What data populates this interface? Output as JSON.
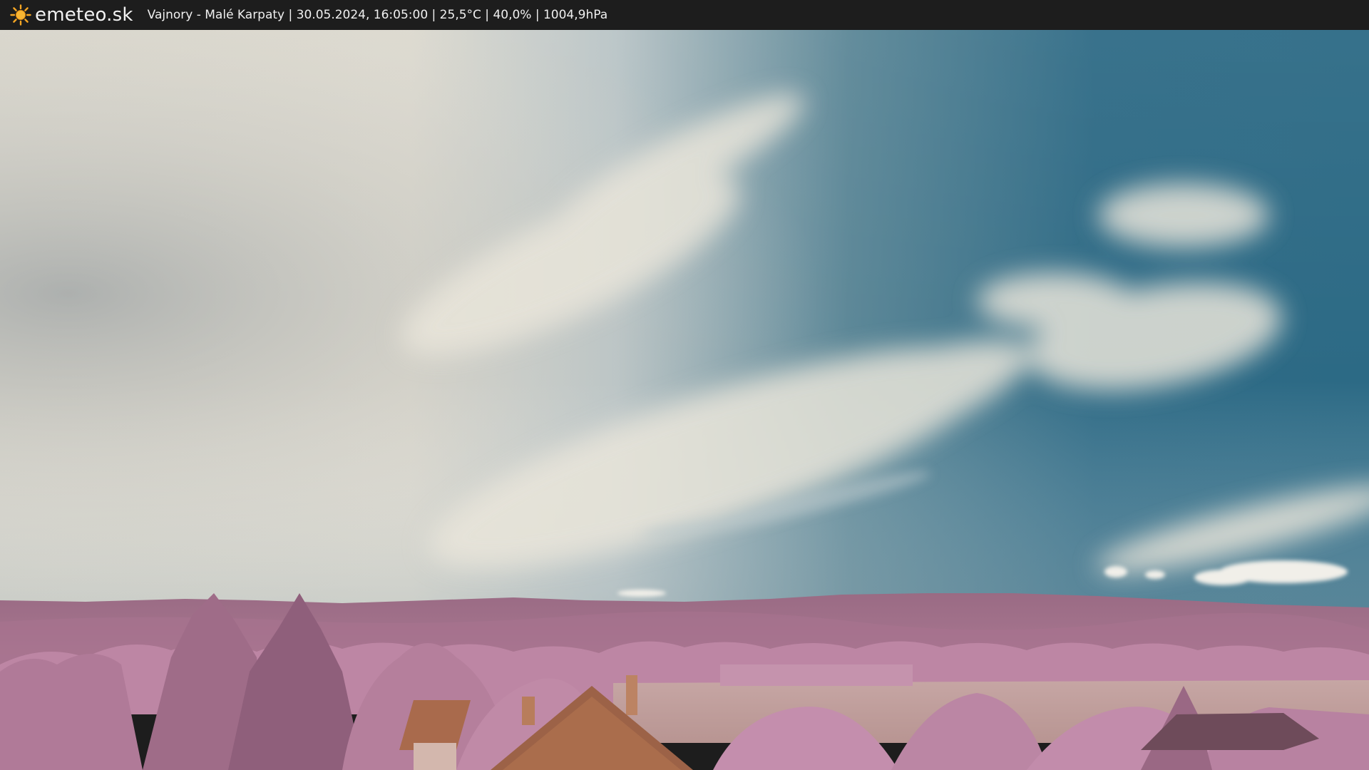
{
  "header": {
    "logo_text": "emeteo.sk",
    "logo_icon": "sun-icon",
    "caption": "Vajnory - Malé Karpaty | 30.05.2024, 16:05:00 | 25,5°C | 40,0% | 1004,9hPa"
  },
  "colors": {
    "bar_background": "#1d1d1d",
    "sun": "#f5a623",
    "sky_blue": "#2a6d8a",
    "cloud": "#e6e1d6",
    "foliage": "#b67c9c",
    "roof": "#b06a48"
  }
}
